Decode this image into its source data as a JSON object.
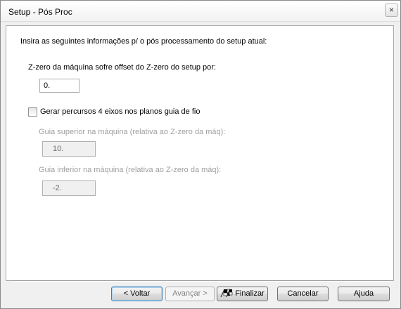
{
  "window": {
    "title": "Setup - Pós Proc",
    "close_glyph": "×"
  },
  "main": {
    "intro_text": "Insira as seguintes informações p/ o pós processamento do setup atual:",
    "offset_label": "Z-zero da máquina sofre offset do Z-zero do setup por:",
    "offset_value": "0.",
    "four_axis_checkbox": {
      "label": "Gerar percursos 4 eixos nos planos guia de fio",
      "checked": false
    },
    "upper_guide": {
      "label": "Guia superior na máquina (relativa ao Z-zero da máq):",
      "value": "10."
    },
    "lower_guide": {
      "label": "Guia inferior na máquina (relativa ao Z-zero da máq):",
      "value": "-2."
    }
  },
  "buttons": {
    "back": "< Voltar",
    "next": "Avançar >",
    "finish": "Finalizar",
    "cancel": "Cancelar",
    "help": "Ajuda"
  },
  "icons": {
    "close": "close-icon",
    "finish": "checkered-flag-icon"
  }
}
